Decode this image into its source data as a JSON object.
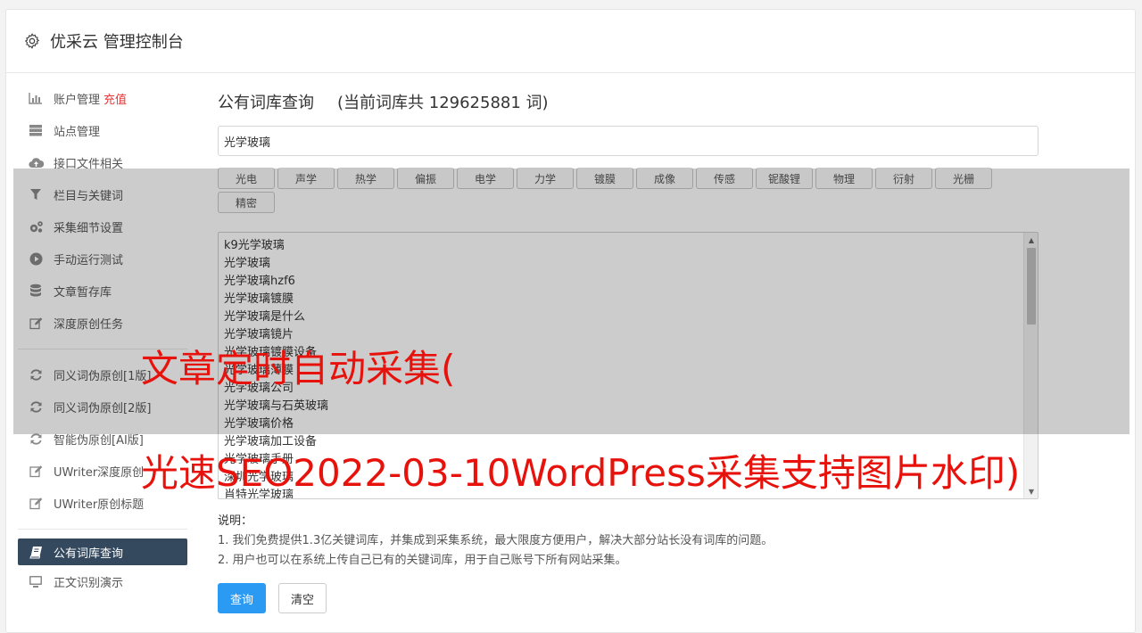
{
  "header": {
    "title": "优采云 管理控制台",
    "icon": "gear-icon"
  },
  "sidebar": {
    "items": [
      {
        "label": "账户管理",
        "extra": "充值",
        "icon": "bar-chart-icon"
      },
      {
        "label": "站点管理",
        "icon": "server-icon"
      },
      {
        "label": "接口文件相关",
        "icon": "cloud-upload-icon"
      },
      {
        "label": "栏目与关键词",
        "icon": "filter-icon"
      },
      {
        "label": "采集细节设置",
        "icon": "gears-icon"
      },
      {
        "label": "手动运行测试",
        "icon": "play-circle-icon"
      },
      {
        "label": "文章暂存库",
        "icon": "database-icon"
      },
      {
        "label": "深度原创任务",
        "icon": "edit-icon"
      }
    ],
    "items2": [
      {
        "label": "同义词伪原创[1版]",
        "icon": "refresh-icon"
      },
      {
        "label": "同义词伪原创[2版]",
        "icon": "refresh-icon"
      },
      {
        "label": "智能伪原创[AI版]",
        "icon": "refresh-icon"
      },
      {
        "label": "UWriter深度原创",
        "icon": "edit-icon"
      },
      {
        "label": "UWriter原创标题",
        "icon": "edit-icon"
      }
    ],
    "active": {
      "label": "公有词库查询",
      "icon": "book-icon"
    },
    "after": {
      "label": "正文识别演示",
      "icon": "monitor-icon"
    }
  },
  "main": {
    "title": "公有词库查询",
    "count_text": "(当前词库共 129625881 词)",
    "search_value": "光学玻璃",
    "tags": [
      "光电",
      "声学",
      "热学",
      "偏振",
      "电学",
      "力学",
      "镀膜",
      "成像",
      "传感",
      "铌酸锂",
      "物理",
      "衍射",
      "光栅",
      "精密"
    ],
    "results": [
      "k9光学玻璃",
      "光学玻璃",
      "光学玻璃hzf6",
      "光学玻璃镀膜",
      "光学玻璃是什么",
      "光学玻璃镜片",
      "光学玻璃镀膜设备",
      "光学玻璃薄膜",
      "光学玻璃公司",
      "光学玻璃与石英玻璃",
      "光学玻璃价格",
      "光学玻璃加工设备",
      "光学玻璃手册",
      "深圳光学玻璃",
      "肖特光学玻璃"
    ],
    "notes_head": "说明：",
    "notes": [
      "1. 我们免费提供1.3亿关键词库，并集成到采集系统，最大限度方便用户，解决大部分站长没有词库的问题。",
      "2. 用户也可以在系统上传自己已有的关键词库，用于自己账号下所有网站采集。"
    ],
    "query_button": "查询",
    "clear_button": "清空"
  },
  "watermark": {
    "line1": "文章定时自动采集(",
    "line2": "光速SEO2022-03-10WordPress采集支持图片水印)",
    "color": "#e8120c"
  }
}
